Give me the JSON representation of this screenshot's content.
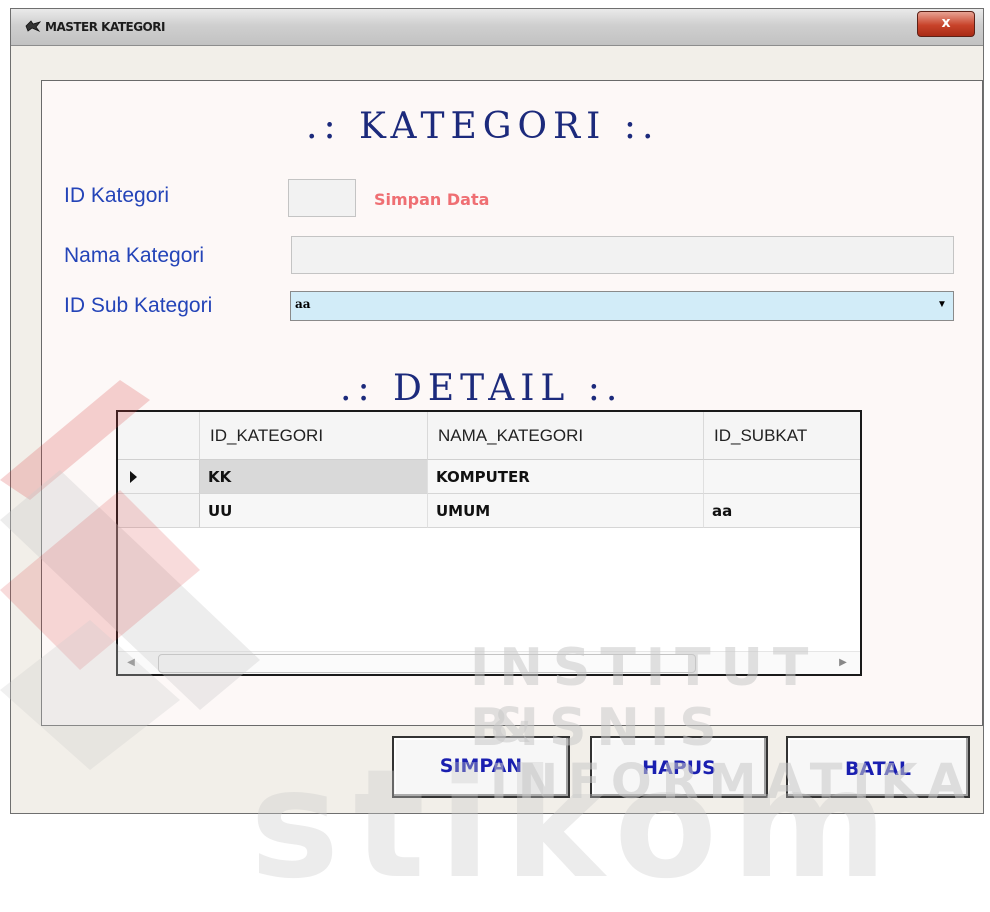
{
  "window": {
    "title": "MASTER KATEGORI",
    "close_label": "x"
  },
  "form": {
    "heading": ".: KATEGORI :.",
    "id_kategori_label": "ID Kategori",
    "id_kategori_value": "",
    "status_hint": "Simpan Data",
    "nama_kategori_label": "Nama Kategori",
    "nama_kategori_value": "",
    "id_sub_kategori_label": "ID Sub Kategori",
    "id_sub_kategori_value": "aa"
  },
  "detail": {
    "heading": ".: DETAIL :.",
    "columns": [
      "ID_KATEGORI",
      "NAMA_KATEGORI",
      "ID_SUBKAT"
    ],
    "rows": [
      [
        "KK",
        "KOMPUTER",
        ""
      ],
      [
        "UU",
        "UMUM",
        "aa"
      ]
    ]
  },
  "buttons": {
    "simpan": "SIMPAN",
    "hapus": "HAPUS",
    "batal": "BATAL"
  },
  "watermark": {
    "line1": "INSTITUT BISNIS",
    "line2": "& INFORMATIKA",
    "logo": "stikom"
  },
  "colors": {
    "label": "#2444b8",
    "heading": "#1c2a7c",
    "hint": "#ef6f73",
    "button_text": "#1a1fb0",
    "combo_bg": "#d2ecf8"
  }
}
